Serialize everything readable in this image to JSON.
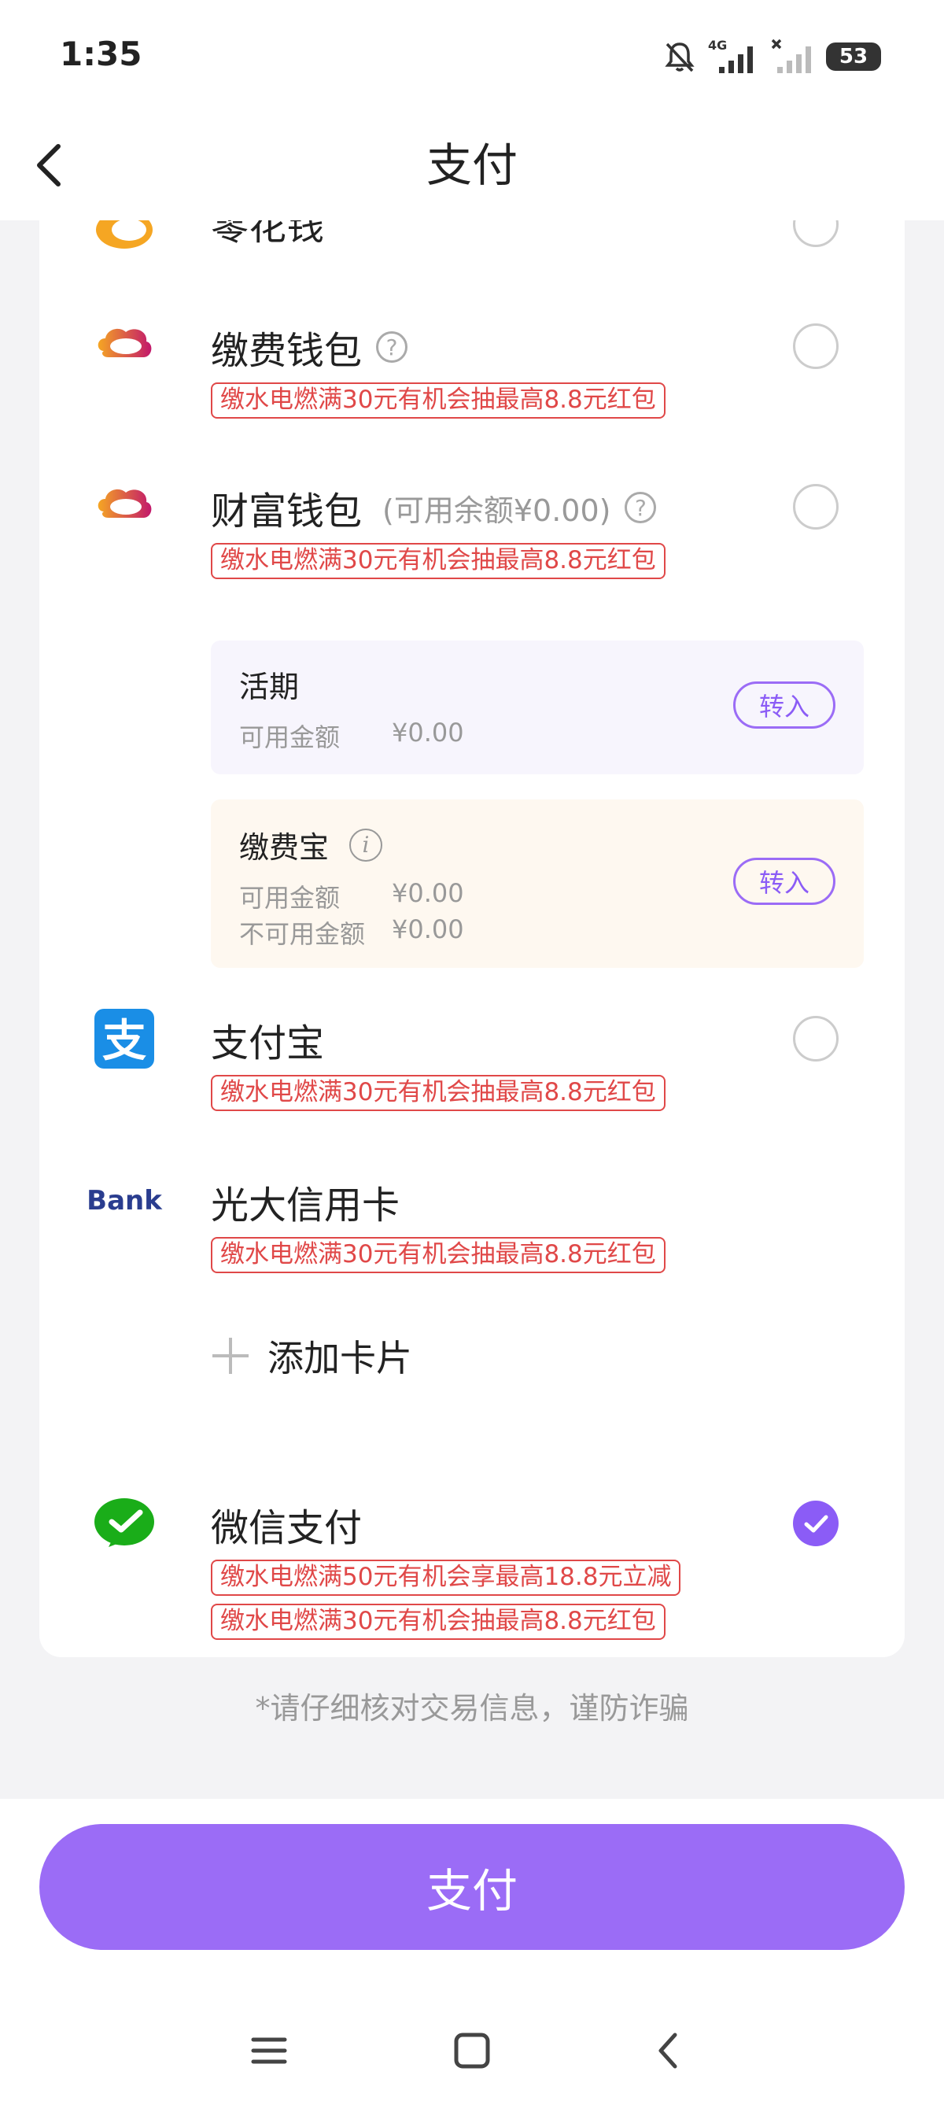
{
  "status_bar": {
    "time": "1:35",
    "battery": "53",
    "network": "4G"
  },
  "header": {
    "title": "支付"
  },
  "partial_item": {
    "name": "零花钱"
  },
  "methods": [
    {
      "name": "缴费钱包",
      "promo": "缴水电燃满30元有机会抽最高8.8元红包"
    },
    {
      "name": "财富钱包",
      "note": "(可用余额¥0.00)",
      "promo": "缴水电燃满30元有机会抽最高8.8元红包"
    },
    {
      "name": "支付宝",
      "promo": "缴水电燃满30元有机会抽最高8.8元红包"
    },
    {
      "name": "光大信用卡",
      "logo_text": "Bank",
      "promo": "缴水电燃满30元有机会抽最高8.8元红包"
    },
    {
      "name": "微信支付",
      "promo1": "缴水电燃满50元有机会享最高18.8元立减",
      "promo2": "缴水电燃满30元有机会抽最高8.8元红包",
      "selected": true
    }
  ],
  "huoqi": {
    "title": "活期",
    "label": "可用金额",
    "value": "¥0.00",
    "button": "转入"
  },
  "jiaofeibao": {
    "title": "缴费宝",
    "label1": "可用金额",
    "value1": "¥0.00",
    "label2": "不可用金额",
    "value2": "¥0.00",
    "button": "转入"
  },
  "add_card": {
    "label": "添加卡片"
  },
  "tip": "*请仔细核对交易信息，谨防诈骗",
  "pay_button": "支付",
  "colors": {
    "accent": "#8b5cf6",
    "promo": "#e04848",
    "huoqi_bg": "#f7f5fd",
    "jiaofeibao_bg": "#fef8f0"
  }
}
